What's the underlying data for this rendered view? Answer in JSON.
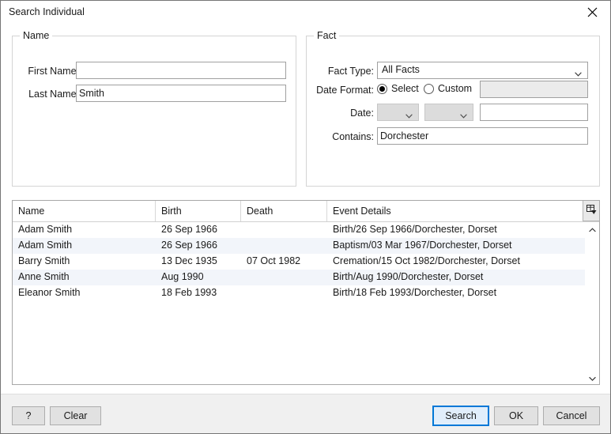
{
  "window": {
    "title": "Search Individual",
    "close_icon": "close-x-icon"
  },
  "name_group": {
    "legend": "Name",
    "first_name": {
      "label": "First Name:",
      "value": "",
      "placeholder": ""
    },
    "last_name": {
      "label": "Last Name:",
      "value": "Smith",
      "placeholder": ""
    }
  },
  "fact_group": {
    "legend": "Fact",
    "fact_type": {
      "label": "Fact Type:",
      "value": "All Facts",
      "options": [
        "All Facts"
      ],
      "chevron_icon": "chevron-down-icon"
    },
    "date_format": {
      "label": "Date Format:",
      "select_option": "Select",
      "custom_option": "Custom",
      "selected": "Select",
      "custom_value": "",
      "custom_enabled": false
    },
    "date": {
      "label": "Date:",
      "modifier_value": "",
      "qualifier_value": "",
      "text_value": "",
      "enabled": false,
      "chevron_icon": "chevron-down-icon"
    },
    "contains": {
      "label": "Contains:",
      "value": "Dorchester"
    }
  },
  "results": {
    "columns": [
      "Name",
      "Birth",
      "Death",
      "Event Details"
    ],
    "column_chooser_icon": "column-chooser-icon",
    "rows": [
      {
        "name": "Adam Smith",
        "birth": "26 Sep 1966",
        "death": "",
        "details": "Birth/26 Sep 1966/Dorchester, Dorset"
      },
      {
        "name": "Adam Smith",
        "birth": "26 Sep 1966",
        "death": "",
        "details": "Baptism/03 Mar 1967/Dorchester, Dorset"
      },
      {
        "name": "Barry Smith",
        "birth": "13 Dec 1935",
        "death": "07 Oct 1982",
        "details": "Cremation/15 Oct 1982/Dorchester, Dorset"
      },
      {
        "name": "Anne Smith",
        "birth": "Aug 1990",
        "death": "",
        "details": "Birth/Aug 1990/Dorchester, Dorset"
      },
      {
        "name": "Eleanor Smith",
        "birth": "18 Feb 1993",
        "death": "",
        "details": "Birth/18 Feb 1993/Dorchester, Dorset"
      }
    ],
    "scrollbar": {
      "up_icon": "chevron-up-icon",
      "down_icon": "chevron-down-icon"
    }
  },
  "footer": {
    "help_label": "?",
    "clear_label": "Clear",
    "search_label": "Search",
    "ok_label": "OK",
    "cancel_label": "Cancel",
    "accent_color": "#0078d7"
  }
}
